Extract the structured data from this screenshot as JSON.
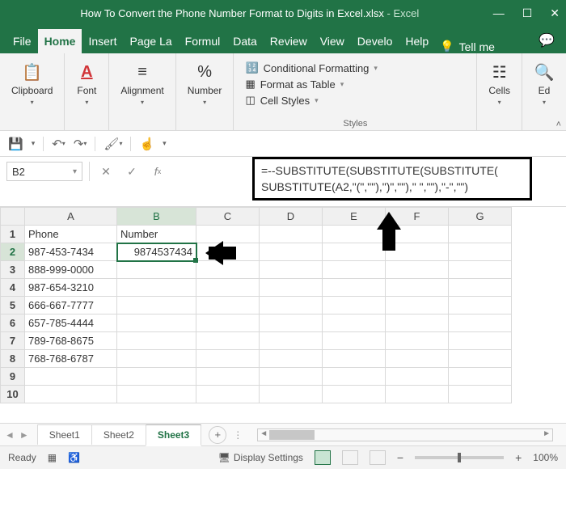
{
  "titlebar": {
    "filename": "How To Convert the Phone Number Format to Digits in Excel.xlsx",
    "sep": " - ",
    "app": "Excel"
  },
  "tabs": [
    "File",
    "Home",
    "Insert",
    "Page La",
    "Formul",
    "Data",
    "Review",
    "View",
    "Develo",
    "Help"
  ],
  "tellme": "Tell me",
  "ribbon": {
    "clipboard": "Clipboard",
    "font": "Font",
    "alignment": "Alignment",
    "number": "Number",
    "styles": "Styles",
    "cells": "Cells",
    "editing": "Ed",
    "cond": "Conditional Formatting",
    "table": "Format as Table",
    "cstyles": "Cell Styles"
  },
  "namebox": "B2",
  "formula_line1": "=--SUBSTITUTE(SUBSTITUTE(SUBSTITUTE(",
  "formula_line2": "SUBSTITUTE(A2,\"(\",\"\"),\")\",\"\"),\" \",\"\"),\"-\",\"\")",
  "columns": [
    "A",
    "B",
    "C",
    "D",
    "E",
    "F",
    "G"
  ],
  "headers": {
    "A": "Phone",
    "B": "Number"
  },
  "rows": [
    {
      "n": "1",
      "A": "Phone",
      "B": "Number"
    },
    {
      "n": "2",
      "A": "987-453-7434",
      "B": "9874537434"
    },
    {
      "n": "3",
      "A": "888-999-0000",
      "B": ""
    },
    {
      "n": "4",
      "A": "987-654-3210",
      "B": ""
    },
    {
      "n": "5",
      "A": "666-667-7777",
      "B": ""
    },
    {
      "n": "6",
      "A": "657-785-4444",
      "B": ""
    },
    {
      "n": "7",
      "A": "789-768-8675",
      "B": ""
    },
    {
      "n": "8",
      "A": "768-768-6787",
      "B": ""
    },
    {
      "n": "9",
      "A": "",
      "B": ""
    },
    {
      "n": "10",
      "A": "",
      "B": ""
    }
  ],
  "sheets": [
    "Sheet1",
    "Sheet2",
    "Sheet3"
  ],
  "active_sheet": "Sheet3",
  "status": {
    "ready": "Ready",
    "display": "Display Settings",
    "zoom_minus": "−",
    "zoom_plus": "+",
    "zoom": "100%"
  }
}
